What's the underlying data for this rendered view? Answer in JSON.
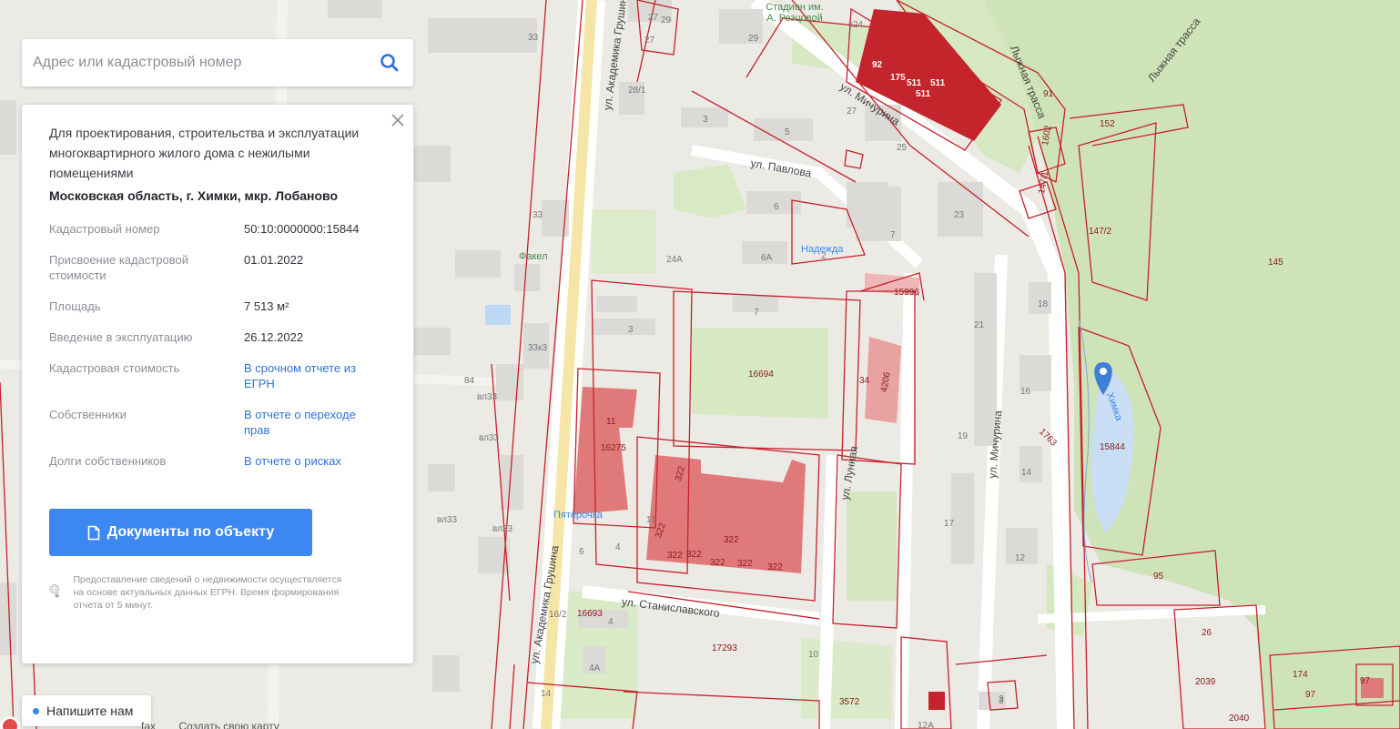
{
  "search": {
    "placeholder": "Адрес или кадастровый номер"
  },
  "info_panel": {
    "purpose": "Для проектирования, строительства и эксплуатации многоквартирного жилого дома с нежилыми помещениями",
    "address": "Московская область, г. Химки, мкр. Лобаново",
    "properties": [
      {
        "label": "Кадастровый номер",
        "value": "50:10:0000000:15844"
      },
      {
        "label": "Присвоение кадастровой стоимости",
        "value": "01.01.2022"
      },
      {
        "label": "Площадь",
        "value": "7 513 м²"
      },
      {
        "label": "Введение в эксплуатацию",
        "value": "26.12.2022"
      },
      {
        "label": "Кадастровая стоимость",
        "link": "В срочном отчете из ЕГРН"
      },
      {
        "label": "Собственники",
        "link": "В отчете о переходе прав"
      },
      {
        "label": "Долги собственников",
        "link": "В отчете о рисках"
      }
    ],
    "docs_button": "Документы по объекту",
    "disclaimer": "Предоставление сведений о недвижимости осуществляется на основе актуальных данных ЕГРН. Время формирования отчета от 5 минут."
  },
  "chat_button": "Напишите нам",
  "bottom_links": [
    "fax",
    "Создать свою карту"
  ],
  "map": {
    "streets": [
      "ул. Академика Грушина",
      "ул. Академика Грушина",
      "ул. Мичурина",
      "ул. Мичурина",
      "ул. Павлова",
      "ул. Станиславского",
      "ул. Лунная",
      "Лыжная трасса",
      "Лыжная трасса"
    ],
    "poi": [
      "Стадион им. А. Резцовой",
      "Надежда",
      "Факел",
      "Пятёрочка",
      "р. Химка"
    ],
    "house_numbers": [
      "33",
      "27",
      "29",
      "27",
      "29",
      "c24",
      "28/1",
      "3",
      "5",
      "27",
      "25",
      "23",
      "7",
      "6",
      "6А",
      "2",
      "24А",
      "33",
      "7",
      "21",
      "18",
      "16",
      "19",
      "14",
      "17",
      "12",
      "3",
      "33к3",
      "вл33",
      "вл33",
      "вл33",
      "вл33",
      "3",
      "4",
      "16/2",
      "4А",
      "14",
      "10",
      "3",
      "12А",
      "84",
      "6",
      "4",
      "11"
    ],
    "parcel_numbers": [
      "92",
      "175",
      "511",
      "511",
      "511",
      "91",
      "152",
      "1602",
      "147/1",
      "147/2",
      "145",
      "15996",
      "16694",
      "34",
      "4206",
      "16275",
      "322",
      "322",
      "322",
      "322",
      "322",
      "322",
      "322",
      "322",
      "1763",
      "15844",
      "95",
      "16693",
      "17293",
      "3572",
      "26",
      "2039",
      "2040",
      "174",
      "97",
      "97",
      "11"
    ]
  },
  "colors": {
    "accent": "#3d88f0",
    "parcel": "#c8202a",
    "building": "#e07a7a"
  }
}
